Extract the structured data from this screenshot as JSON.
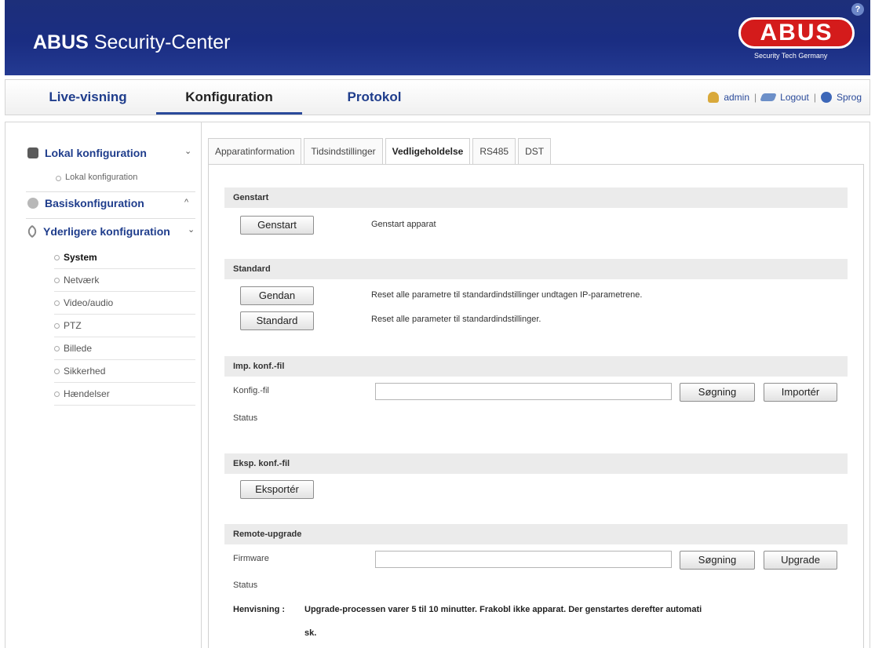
{
  "header": {
    "app_title_bold": "ABUS",
    "app_title_rest": " Security-Center",
    "logo_text": "ABUS",
    "logo_tagline": "Security Tech Germany",
    "help_label": "?"
  },
  "nav": {
    "tabs": [
      {
        "label": "Live-visning"
      },
      {
        "label": "Konfiguration"
      },
      {
        "label": "Protokol"
      }
    ],
    "user": "admin",
    "logout": "Logout",
    "language": "Sprog",
    "separator": "|"
  },
  "sidebar": {
    "local": {
      "label": "Lokal konfiguration",
      "chev": "⌄",
      "sub": "Lokal konfiguration"
    },
    "basis": {
      "label": "Basiskonfiguration",
      "chev": "^"
    },
    "extra": {
      "label": "Yderligere konfiguration",
      "chev": "⌄",
      "items": [
        {
          "label": "System"
        },
        {
          "label": "Netværk"
        },
        {
          "label": "Video/audio"
        },
        {
          "label": "PTZ"
        },
        {
          "label": "Billede"
        },
        {
          "label": "Sikkerhed"
        },
        {
          "label": "Hændelser"
        }
      ]
    }
  },
  "tabs": [
    {
      "label": "Apparatinformation"
    },
    {
      "label": "Tidsindstillinger"
    },
    {
      "label": "Vedligeholdelse"
    },
    {
      "label": "RS485"
    },
    {
      "label": "DST"
    }
  ],
  "sections": {
    "genstart": {
      "title": "Genstart",
      "button": "Genstart",
      "desc": "Genstart apparat"
    },
    "standard": {
      "title": "Standard",
      "restore_button": "Gendan",
      "restore_desc": "Reset alle parametre til standardindstillinger undtagen IP-parametrene.",
      "default_button": "Standard",
      "default_desc": "Reset alle parameter til standardindstillinger."
    },
    "import": {
      "title": "Imp. konf.-fil",
      "file_label": "Konfig.-fil",
      "file_value": "",
      "browse_button": "Søgning",
      "import_button": "Importér",
      "status_label": "Status"
    },
    "export": {
      "title": "Eksp. konf.-fil",
      "button": "Eksportér"
    },
    "upgrade": {
      "title": "Remote-upgrade",
      "firmware_label": "Firmware",
      "firmware_value": "",
      "browse_button": "Søgning",
      "upgrade_button": "Upgrade",
      "status_label": "Status",
      "note_label": "Henvisning :",
      "note_text": "Upgrade-processen varer 5 til 10 minutter. Frakobl ikke apparat. Der genstartes derefter automati",
      "note_text_wrap": "sk."
    }
  }
}
